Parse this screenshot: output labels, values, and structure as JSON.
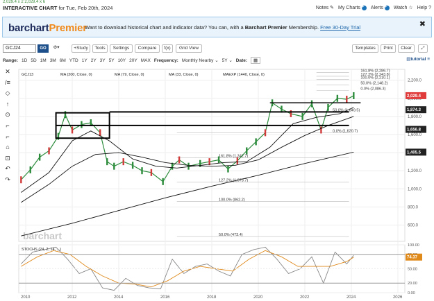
{
  "header": {
    "ticker_mini": "2,029.4 x 2   2,029.4 x 6",
    "chart_title": "INTERACTIVE CHART",
    "chart_subtitle": "for Tue, Feb 20th, 2024",
    "links": [
      {
        "label": "Notes",
        "icon": "note-icon"
      },
      {
        "label": "My Charts",
        "icon": "plus-circle-icon"
      },
      {
        "label": "Alerts",
        "icon": "plus-circle-icon"
      },
      {
        "label": "Watch",
        "icon": "star-icon"
      },
      {
        "label": "Help",
        "icon": "question-circle-icon"
      }
    ]
  },
  "banner": {
    "logo_main": "barchart",
    "logo_accent": "Premier",
    "message": "Want to download historical chart and indicator data? You can, with a",
    "message_bold": "Barchart Premier",
    "message_tail": "Membership.",
    "link": "Free 30-Day Trial",
    "close": "✖"
  },
  "toolbar": {
    "symbol_value": "GCJ24",
    "go_label": "GO",
    "settings_glyph": "⚙▾",
    "buttons": [
      "+Study",
      "Tools",
      "Settings",
      "Compare",
      "f(x)",
      "Grid View"
    ],
    "right_buttons": [
      "Templates",
      "Print",
      "Clear",
      "⤢"
    ]
  },
  "rangebar": {
    "range_label": "Range:",
    "ranges": [
      "1D",
      "5D",
      "1M",
      "3M",
      "6M",
      "YTD",
      "1Y",
      "2Y",
      "3Y",
      "5Y",
      "10Y",
      "20Y",
      "MAX"
    ],
    "frequency_label": "Frequency:",
    "frequency_value": "Monthly Nearby",
    "period_value": "5Y",
    "date_label": "Date:",
    "tutorial": "tutorial"
  },
  "sidetools": [
    "✕",
    "/≡",
    "◇",
    "↑",
    "⊙",
    "⌐",
    "⌐",
    "⌂",
    "⊡",
    "↶",
    "↷"
  ],
  "chart_data": {
    "type": "line",
    "instrument_legend": "GCJ13",
    "studies": [
      {
        "name": "MA (200, Close, 0)"
      },
      {
        "name": "MA (79, Close, 0)"
      },
      {
        "name": "MA (33, Close, 0)"
      },
      {
        "name": "MAEXP (1440, Close, 0)"
      }
    ],
    "x_ticks": [
      "2010",
      "2012",
      "2014",
      "2016",
      "2018",
      "2020",
      "2022",
      "2024",
      "2026"
    ],
    "x_tick_years": [
      2010,
      2012,
      2014,
      2016,
      2018,
      2020,
      2022,
      2024,
      2026
    ],
    "y_ticks": [
      "2,200.0",
      "2,000.0",
      "1,800.0",
      "1,600.0",
      "1,400.0",
      "1,200.0",
      "1,000.0",
      "800.0",
      "600.0"
    ],
    "y_tick_values": [
      2200,
      2000,
      1800,
      1600,
      1400,
      1200,
      1000,
      800,
      600
    ],
    "ylim": [
      420,
      2320
    ],
    "xlim": [
      2009.7,
      2026.3
    ],
    "price_labels": [
      {
        "label": "2,029.4",
        "value": 2029.4,
        "color": "#e03c3c"
      },
      {
        "label": "1,874.3",
        "value": 1874.3,
        "color": "#222222"
      },
      {
        "label": "1,656.8",
        "value": 1656.8,
        "color": "#222222"
      },
      {
        "label": "1,405.5",
        "value": 1405.5,
        "color": "#222222"
      }
    ],
    "fib_levels": [
      {
        "label": "161.8% (2,286.7)",
        "value": 2286.7
      },
      {
        "label": "127.2% (2,243.8)",
        "value": 2243.8
      },
      {
        "label": "100.0% (2,210.1)",
        "value": 2210.1
      },
      {
        "label": "50.0% (2,148.2)",
        "value": 2148.2
      },
      {
        "label": "0.0% (2,086.3)",
        "value": 2086.3
      },
      {
        "label": "50.0% (1,849.5)",
        "value": 1849.5
      },
      {
        "label": "0.0% (1,620.7)",
        "value": 1620.7
      },
      {
        "label": "161.8% (1,342.7)",
        "value": 1342.7
      },
      {
        "label": "127.2% (1,073.7)",
        "value": 1073.7
      },
      {
        "label": "100.0% (862.2)",
        "value": 862.2
      },
      {
        "label": "50.0% (473.4)",
        "value": 473.4
      }
    ],
    "watermark": "barchart",
    "stoch": {
      "legend": "STOCHS (24, 2, 14, ...)",
      "y_ticks": [
        "100.00",
        "80.00",
        "50.00",
        "20.00",
        "0.00"
      ],
      "y_tick_values": [
        100,
        80,
        50,
        20,
        0
      ],
      "last_label": "74.37",
      "last_value": 74.37
    },
    "series": [
      {
        "name": "GCJ13",
        "color": "#2c8c3c",
        "x": [
          2009.8,
          2010.2,
          2010.6,
          2011.0,
          2011.4,
          2011.7,
          2012.0,
          2012.4,
          2012.8,
          2013.2,
          2013.5,
          2013.8,
          2014.2,
          2014.6,
          2015.0,
          2015.4,
          2015.9,
          2016.3,
          2016.6,
          2017.0,
          2017.5,
          2017.9,
          2018.3,
          2018.7,
          2019.1,
          2019.5,
          2019.9,
          2020.3,
          2020.6,
          2021.0,
          2021.4,
          2021.9,
          2022.3,
          2022.7,
          2023.0,
          2023.4,
          2023.8,
          2024.1
        ],
        "y": [
          1100,
          1210,
          1350,
          1420,
          1580,
          1820,
          1650,
          1710,
          1730,
          1620,
          1300,
          1250,
          1300,
          1260,
          1200,
          1180,
          1080,
          1250,
          1320,
          1250,
          1280,
          1300,
          1320,
          1220,
          1310,
          1420,
          1520,
          1620,
          1950,
          1880,
          1830,
          1800,
          1940,
          1650,
          1900,
          2000,
          1990,
          2029
        ]
      },
      {
        "name": "MA (33, Close, 0)",
        "color": "#111111",
        "x": [
          2009.8,
          2011.0,
          2012.0,
          2012.8,
          2013.6,
          2014.6,
          2015.6,
          2016.5,
          2017.5,
          2018.5,
          2019.5,
          2020.5,
          2021.5,
          2022.5,
          2023.5,
          2024.1
        ],
        "y": [
          960,
          1180,
          1530,
          1640,
          1530,
          1330,
          1250,
          1230,
          1260,
          1290,
          1300,
          1460,
          1720,
          1790,
          1830,
          1900
        ]
      },
      {
        "name": "MA (79, Close, 0)",
        "color": "#111111",
        "x": [
          2009.8,
          2011.0,
          2012.0,
          2013.0,
          2014.0,
          2015.0,
          2016.0,
          2017.0,
          2018.0,
          2019.0,
          2020.0,
          2021.0,
          2022.0,
          2023.0,
          2024.1
        ],
        "y": [
          850,
          1050,
          1250,
          1380,
          1400,
          1350,
          1290,
          1260,
          1250,
          1260,
          1320,
          1460,
          1590,
          1700,
          1800
        ]
      },
      {
        "name": "MA (200, Close, 0)",
        "color": "#111111",
        "x": [
          2009.8,
          2012.0,
          2014.0,
          2016.0,
          2018.0,
          2020.0,
          2022.0,
          2024.1
        ],
        "y": [
          480,
          620,
          760,
          900,
          1030,
          1150,
          1280,
          1405
        ]
      },
      {
        "name": "STOCHS %K",
        "color": "#888888",
        "x": [
          2009.8,
          2010.3,
          2010.8,
          2011.3,
          2011.8,
          2012.3,
          2012.8,
          2013.3,
          2013.8,
          2014.3,
          2014.8,
          2015.3,
          2015.8,
          2016.3,
          2016.8,
          2017.3,
          2017.8,
          2018.3,
          2018.8,
          2019.3,
          2019.8,
          2020.3,
          2020.8,
          2021.3,
          2021.8,
          2022.3,
          2022.8,
          2023.3,
          2023.8,
          2024.1
        ],
        "y": [
          60,
          85,
          90,
          95,
          70,
          40,
          50,
          10,
          5,
          30,
          15,
          10,
          8,
          70,
          40,
          55,
          60,
          45,
          35,
          80,
          90,
          95,
          70,
          40,
          50,
          75,
          20,
          85,
          60,
          78
        ]
      },
      {
        "name": "STOCHS %D",
        "color": "#e08a1c",
        "x": [
          2009.8,
          2010.5,
          2011.2,
          2011.9,
          2012.6,
          2013.3,
          2014.0,
          2014.7,
          2015.4,
          2016.1,
          2016.8,
          2017.5,
          2018.2,
          2018.9,
          2019.6,
          2020.3,
          2021.0,
          2021.7,
          2022.4,
          2023.1,
          2023.8,
          2024.1
        ],
        "y": [
          55,
          75,
          88,
          80,
          55,
          35,
          20,
          18,
          12,
          25,
          45,
          55,
          50,
          45,
          70,
          88,
          75,
          55,
          55,
          55,
          65,
          74
        ]
      }
    ]
  }
}
